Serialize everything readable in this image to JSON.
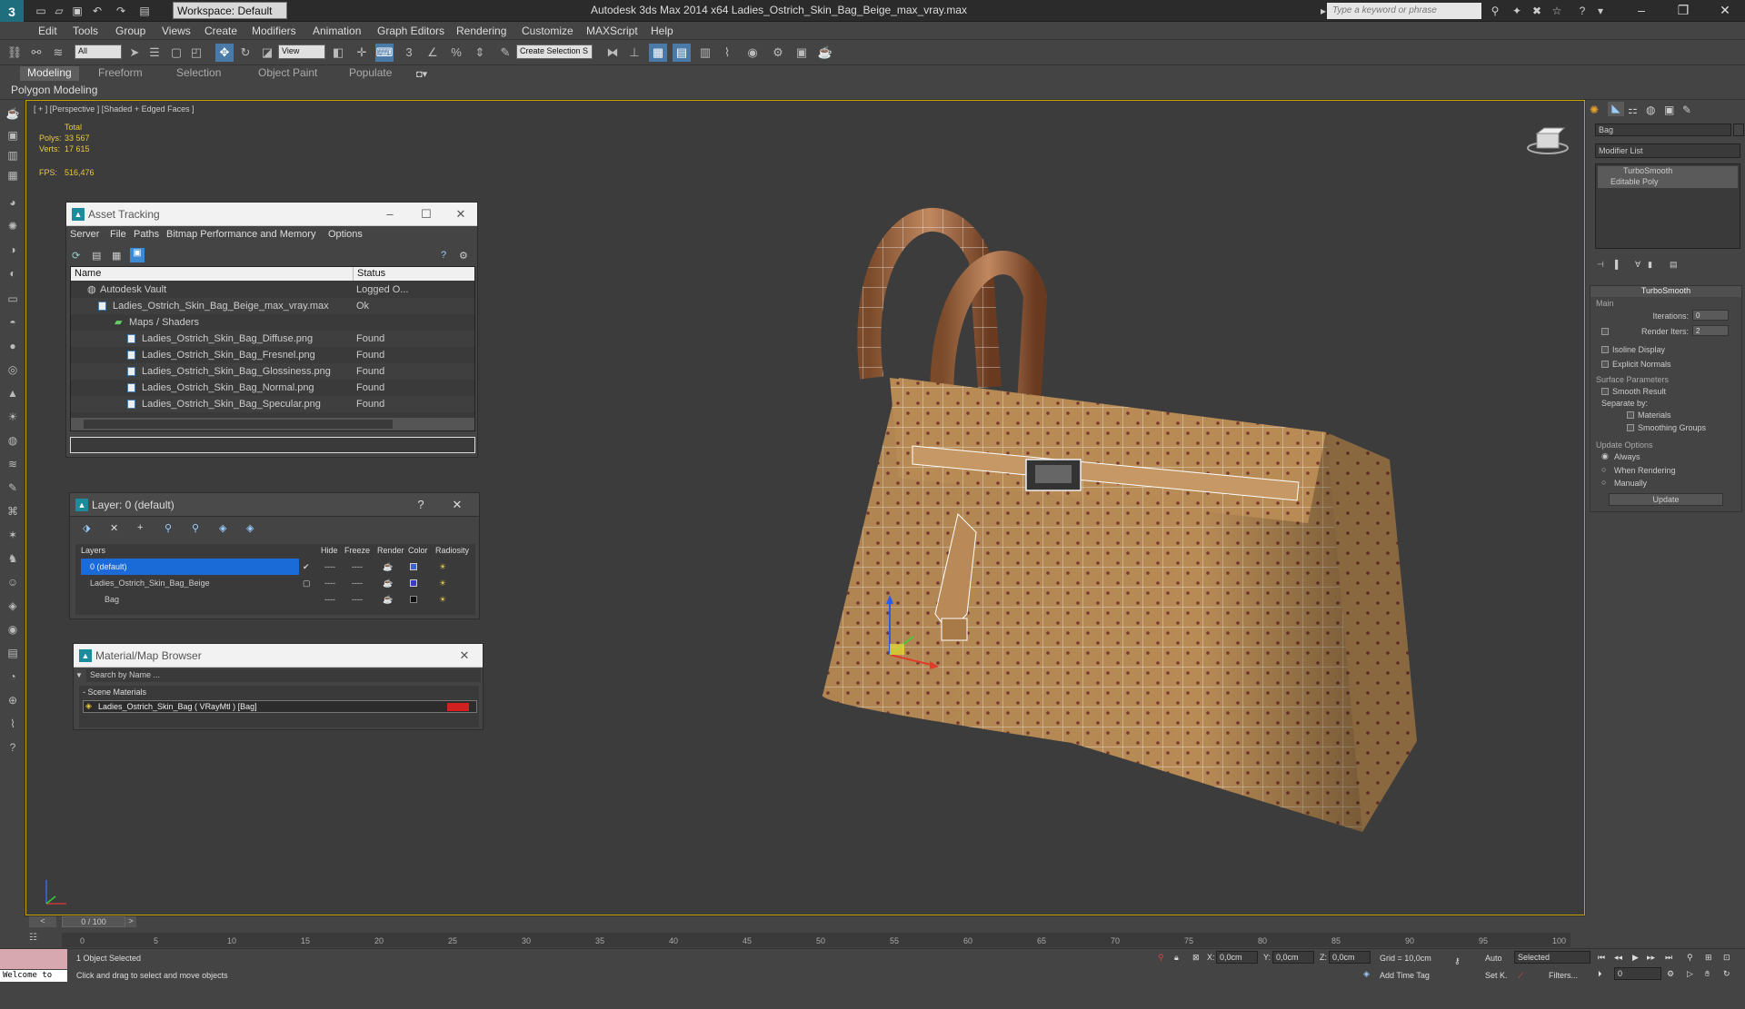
{
  "titlebar": {
    "workspace_label": "Workspace: Default",
    "title": "Autodesk 3ds Max  2014 x64      Ladies_Ostrich_Skin_Bag_Beige_max_vray.max",
    "search_placeholder": "Type a keyword or phrase"
  },
  "menu": [
    "Edit",
    "Tools",
    "Group",
    "Views",
    "Create",
    "Modifiers",
    "Animation",
    "Graph Editors",
    "Rendering",
    "Customize",
    "MAXScript",
    "Help"
  ],
  "toolbar": {
    "filter_value": "All",
    "refcoord_value": "View",
    "selection_set_placeholder": "Create Selection S"
  },
  "ribbon": {
    "tabs": [
      "Modeling",
      "Freeform",
      "Selection",
      "Object Paint",
      "Populate"
    ],
    "panel_label": "Polygon Modeling"
  },
  "viewport": {
    "label": "[ + ] [Perspective ] [Shaded + Edged Faces ]",
    "stats_total": "Total",
    "polys_label": "Polys:",
    "polys_value": "33 567",
    "verts_label": "Verts:",
    "verts_value": "17 615",
    "fps_label": "FPS:",
    "fps_value": "516,476"
  },
  "asset_tracking": {
    "title": "Asset Tracking",
    "menu": [
      "Server",
      "File",
      "Paths",
      "Bitmap Performance and Memory",
      "Options"
    ],
    "col_name": "Name",
    "col_status": "Status",
    "rows": [
      {
        "name": "Autodesk Vault",
        "status": "Logged O..."
      },
      {
        "name": "Ladies_Ostrich_Skin_Bag_Beige_max_vray.max",
        "status": "Ok"
      },
      {
        "name": "Maps / Shaders",
        "status": ""
      },
      {
        "name": "Ladies_Ostrich_Skin_Bag_Diffuse.png",
        "status": "Found"
      },
      {
        "name": "Ladies_Ostrich_Skin_Bag_Fresnel.png",
        "status": "Found"
      },
      {
        "name": "Ladies_Ostrich_Skin_Bag_Glossiness.png",
        "status": "Found"
      },
      {
        "name": "Ladies_Ostrich_Skin_Bag_Normal.png",
        "status": "Found"
      },
      {
        "name": "Ladies_Ostrich_Skin_Bag_Specular.png",
        "status": "Found"
      }
    ]
  },
  "layer": {
    "title": "Layer: 0 (default)",
    "help": "?",
    "cols": [
      "Layers",
      "Hide",
      "Freeze",
      "Render",
      "Color",
      "Radiosity"
    ],
    "rows": [
      {
        "name": "0 (default)",
        "hide": "----",
        "freeze": "----",
        "color": "#3a64c8"
      },
      {
        "name": "Ladies_Ostrich_Skin_Bag_Beige",
        "hide": "----",
        "freeze": "----",
        "color": "#3a3ac8"
      },
      {
        "name": "Bag",
        "hide": "----",
        "freeze": "----",
        "color": "#111111"
      }
    ]
  },
  "material_browser": {
    "title": "Material/Map Browser",
    "search_placeholder": "Search by Name ...",
    "section": "- Scene Materials",
    "item": "Ladies_Ostrich_Skin_Bag  ( VRayMtl ) [Bag]"
  },
  "command_panel": {
    "object_name": "Bag",
    "modifier_list": "Modifier List",
    "stack": [
      "TurboSmooth",
      "Editable Poly"
    ],
    "rollout_title": "TurboSmooth",
    "main_label": "Main",
    "iterations_label": "Iterations:",
    "iterations_value": "0",
    "render_iters_label": "Render Iters:",
    "render_iters_value": "2",
    "isoline": "Isoline Display",
    "explicit": "Explicit Normals",
    "surface_params": "Surface Parameters",
    "smooth_result": "Smooth Result",
    "separate_by": "Separate by:",
    "materials": "Materials",
    "smoothing_groups": "Smoothing Groups",
    "update_options": "Update Options",
    "always": "Always",
    "when_rendering": "When Rendering",
    "manually": "Manually",
    "update_button": "Update"
  },
  "timeline": {
    "slider": "0 / 100",
    "ticks": [
      "0",
      "5",
      "10",
      "15",
      "20",
      "25",
      "30",
      "35",
      "40",
      "45",
      "50",
      "55",
      "60",
      "65",
      "70",
      "75",
      "80",
      "85",
      "90",
      "95",
      "100"
    ]
  },
  "status": {
    "welcome": "Welcome to",
    "selected": "1 Object Selected",
    "prompt": "Click and drag to select and move objects",
    "x_label": "X:",
    "x_value": "0,0cm",
    "y_label": "Y:",
    "y_value": "0,0cm",
    "z_label": "Z:",
    "z_value": "0,0cm",
    "grid": "Grid = 10,0cm",
    "add_time_tag": "Add Time Tag",
    "auto": "Auto",
    "set_k": "Set K.",
    "selected_dropdown": "Selected",
    "filters": "Filters...",
    "frame": "0"
  }
}
